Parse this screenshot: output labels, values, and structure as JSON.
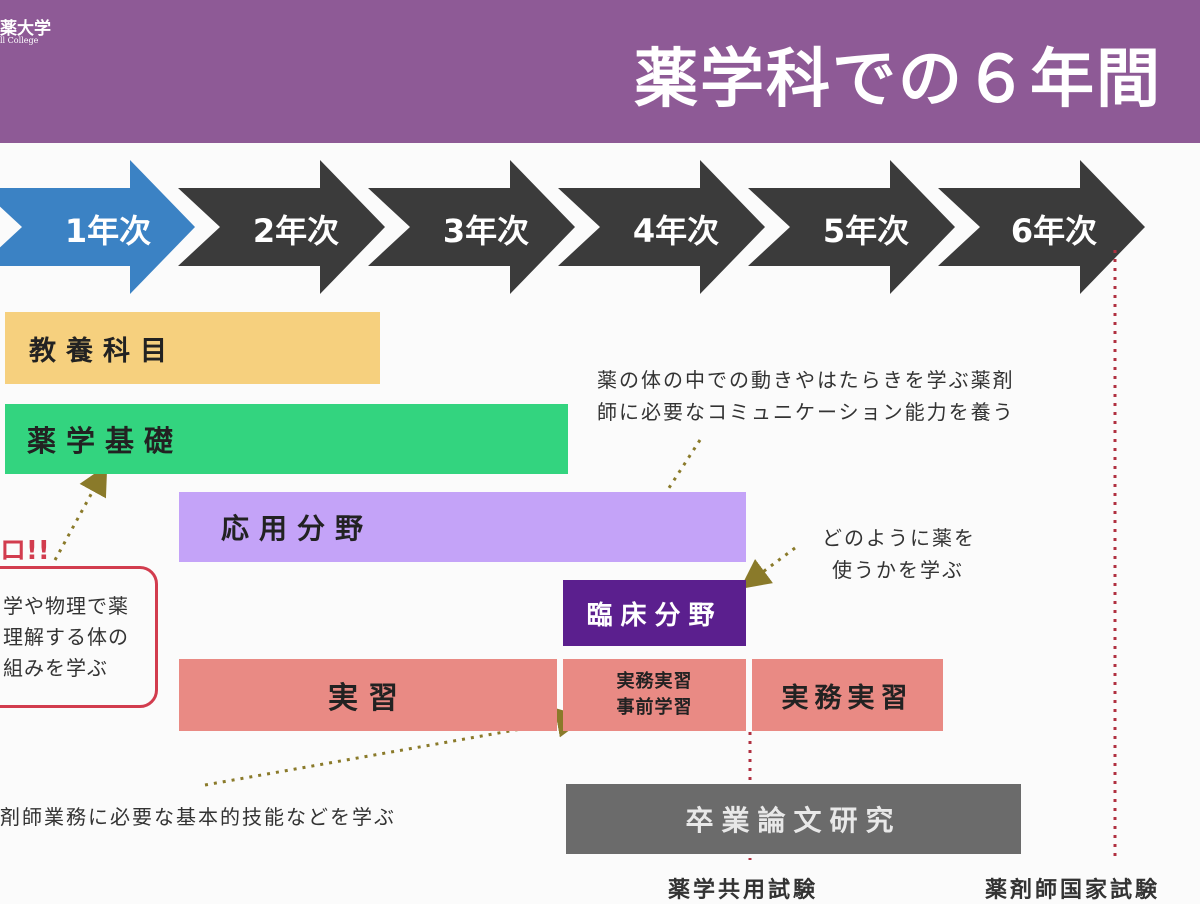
{
  "header": {
    "logo_text": "薬大学",
    "logo_subtext": "ll College",
    "title": "薬学科での６年間"
  },
  "years": [
    "1年次",
    "2年次",
    "3年次",
    "4年次",
    "5年次",
    "6年次"
  ],
  "bars": {
    "liberal_arts": "教養科目",
    "pharma_basics": "薬学基礎",
    "applied": "応用分野",
    "clinical": "臨床分野",
    "practice": "実習",
    "pre_practice_line1": "実務実習",
    "pre_practice_line2": "事前学習",
    "practical_training": "実務実習",
    "thesis": "卒業論文研究"
  },
  "notes": {
    "body_note_line1": "薬の体の中での動きやはたらきを学ぶ薬剤",
    "body_note_line2": "師に必要なコミュニケーション能力を養う",
    "use_note_line1": "どのように薬を",
    "use_note_line2": "使うかを学ぶ",
    "skills_note": "剤師業務に必要な基本的技能などを学ぶ",
    "exclaim": "ロ!!",
    "red_line1": "学や物理で薬",
    "red_line2": "理解する体の",
    "red_line3": "組みを学ぶ"
  },
  "bottom": {
    "common_exam": "薬学共用試験",
    "national_exam": "薬剤師国家試験"
  },
  "colors": {
    "header": "#8e5a96",
    "arrow_active": "#3b82c4",
    "arrow": "#3b3b3b",
    "liberal_arts": "#f6d07e",
    "pharma_basics": "#33d47f",
    "applied": "#c4a3f8",
    "clinical": "#5b1f8e",
    "practice": "#e98a84",
    "thesis": "#6b6b6b",
    "dotted_arrow": "#8a7a2a",
    "dotted_red": "#b03040"
  }
}
